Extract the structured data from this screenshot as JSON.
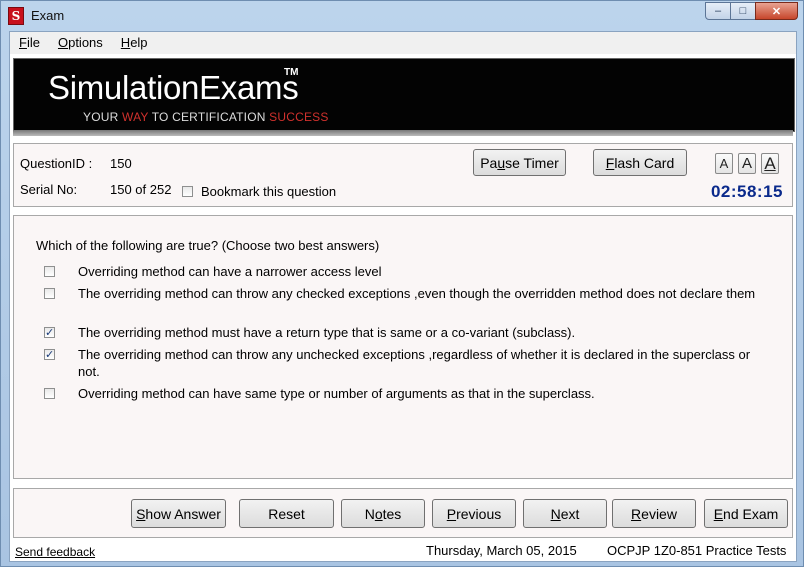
{
  "window": {
    "title": "Exam",
    "app_icon_glyph": "S",
    "controls": {
      "minimize": "–",
      "maximize": "□",
      "close": "✕"
    }
  },
  "menu": {
    "items": [
      {
        "label_hotkey": "F",
        "label_rest": "ile"
      },
      {
        "label_hotkey": "O",
        "label_rest": "ptions"
      },
      {
        "label_hotkey": "H",
        "label_rest": "elp"
      }
    ]
  },
  "banner": {
    "brand": "SimulationExams",
    "tm": "TM",
    "tagline_parts": [
      "YOUR ",
      "WAY",
      " TO CERTIFICATION ",
      "SUCCESS"
    ]
  },
  "info": {
    "question_id_label": "QuestionID :",
    "question_id_value": "150",
    "serial_label": "Serial No:",
    "serial_value": "150 of 252",
    "bookmark_label": "Bookmark this question",
    "bookmark_checked": false,
    "pause_timer_label_pre": "Pa",
    "pause_timer_label_hotkey": "u",
    "pause_timer_label_post": "se Timer",
    "flash_card_label_hotkey": "F",
    "flash_card_label_rest": "lash Card",
    "font_buttons": [
      "A",
      "A",
      "A"
    ],
    "timer": "02:58:15"
  },
  "question": {
    "text": "Which of the following are true? (Choose two best answers)",
    "options": [
      {
        "text": "Overriding method can have a narrower access  level",
        "checked": false
      },
      {
        "text": "The overriding method can throw any checked exceptions ,even though the overridden method does not declare them",
        "checked": false
      },
      {
        "text": "The overriding method must have a return type that is same or a co-variant (subclass).",
        "checked": true
      },
      {
        "text": "The overriding method can throw any unchecked exceptions ,regardless of whether it is declared in the superclass or not.",
        "checked": true
      },
      {
        "text": "Overriding method can have same type or number of arguments as that in the superclass.",
        "checked": false
      }
    ]
  },
  "actions": {
    "show_answer": {
      "hotkey": "S",
      "rest": "how Answer"
    },
    "reset": {
      "label": "Reset"
    },
    "notes": {
      "pre": "N",
      "hotkey": "o",
      "rest": "tes"
    },
    "previous": {
      "hotkey": "P",
      "rest": "revious"
    },
    "next": {
      "hotkey": "N",
      "rest": "ext"
    },
    "review": {
      "hotkey": "R",
      "rest": "eview"
    },
    "end_exam": {
      "hotkey": "E",
      "rest": "nd Exam"
    }
  },
  "footer": {
    "feedback": "Send feedback",
    "date": "Thursday, March 05, 2015",
    "product": "OCPJP 1Z0-851 Practice Tests"
  },
  "check_glyph": "✓"
}
